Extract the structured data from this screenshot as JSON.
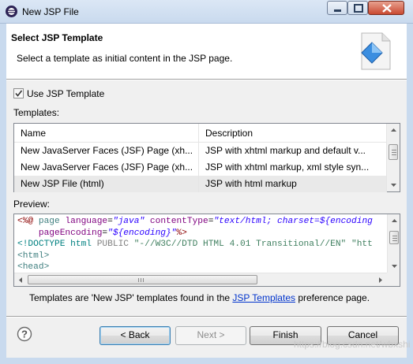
{
  "window": {
    "title": "New JSP File"
  },
  "header": {
    "title": "Select JSP Template",
    "description": "Select a template as initial content in the JSP page."
  },
  "use_template": {
    "label": "Use JSP Template",
    "checked": true
  },
  "templates": {
    "label": "Templates:",
    "columns": [
      "Name",
      "Description"
    ],
    "rows": [
      {
        "name": "New JavaServer Faces (JSF) Page (xh...",
        "description": "JSP with xhtml markup and default v..."
      },
      {
        "name": "New JavaServer Faces (JSF) Page (xh...",
        "description": "JSP with xhtml markup, xml style syn..."
      },
      {
        "name": "New JSP File (html)",
        "description": "JSP with html markup",
        "selected": true
      }
    ]
  },
  "preview": {
    "label": "Preview:",
    "lines": [
      {
        "segments": [
          {
            "text": "<%@ ",
            "color": "#8b0000"
          },
          {
            "text": "page ",
            "color": "#3f7f7f"
          },
          {
            "text": "language",
            "color": "#7f007f"
          },
          {
            "text": "=",
            "color": "#000000"
          },
          {
            "text": "\"java\"",
            "color": "#2a00ff",
            "italic": true
          },
          {
            "text": " contentType",
            "color": "#7f007f"
          },
          {
            "text": "=",
            "color": "#000000"
          },
          {
            "text": "\"text/html; charset=${encoding",
            "color": "#2a00ff",
            "italic": true
          }
        ]
      },
      {
        "segments": [
          {
            "text": "    pageEncoding",
            "color": "#7f007f"
          },
          {
            "text": "=",
            "color": "#000000"
          },
          {
            "text": "\"${encoding}\"",
            "color": "#2a00ff",
            "italic": true
          },
          {
            "text": "%>",
            "color": "#8b0000"
          }
        ]
      },
      {
        "segments": [
          {
            "text": "<!DOCTYPE html ",
            "color": "#008080"
          },
          {
            "text": "PUBLIC ",
            "color": "#808080"
          },
          {
            "text": "\"-//W3C//DTD HTML 4.01 Transitional//EN\" \"htt",
            "color": "#3f7f5f"
          }
        ]
      },
      {
        "segments": [
          {
            "text": "<html>",
            "color": "#3f7f7f"
          }
        ]
      },
      {
        "segments": [
          {
            "text": "<head>",
            "color": "#3f7f7f"
          }
        ]
      }
    ]
  },
  "info": {
    "prefix": "Templates are 'New JSP' templates found in the ",
    "link": "JSP Templates",
    "suffix": " preference page."
  },
  "buttons": {
    "back": "< Back",
    "next": "Next >",
    "finish": "Finish",
    "cancel": "Cancel"
  },
  "watermark": "https://blog.csdn.net/wbxshi",
  "icons": [
    "eclipse-icon",
    "minimize-icon",
    "maximize-icon",
    "close-icon",
    "wizard-banner-icon",
    "help-icon",
    "scroll-up-icon",
    "scroll-down-icon",
    "scroll-left-icon",
    "scroll-right-icon"
  ]
}
